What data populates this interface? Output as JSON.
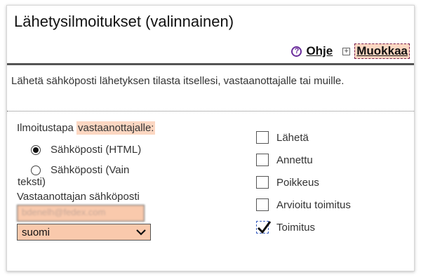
{
  "title": "Lähetysilmoitukset (valinnainen)",
  "toolbar": {
    "help": "Ohje",
    "edit": "Muokkaa"
  },
  "description": "Lähetä sähköposti lähetyksen tilasta itsellesi, vastaanottajalle tai muille.",
  "notification": {
    "label_prefix": "Ilmoitustapa ",
    "label_highlight": "vastaanottajalle:",
    "options": [
      {
        "label_1": "Sähköposti (HTML)",
        "label_2": "",
        "checked": true
      },
      {
        "label_1": "Sähköposti (Vain",
        "label_2": "teksti)",
        "checked": false
      }
    ]
  },
  "recipient_email": {
    "label": "Vastaanottajan sähköposti",
    "value": "bdenelh@fedex.com"
  },
  "language": {
    "selected": "suomi"
  },
  "events": [
    {
      "label": "Lähetä",
      "checked": false
    },
    {
      "label": "Annettu",
      "checked": false
    },
    {
      "label": "Poikkeus",
      "checked": false
    },
    {
      "label": "Arvioitu toimitus",
      "checked": false
    },
    {
      "label": "Toimitus",
      "checked": true
    }
  ]
}
